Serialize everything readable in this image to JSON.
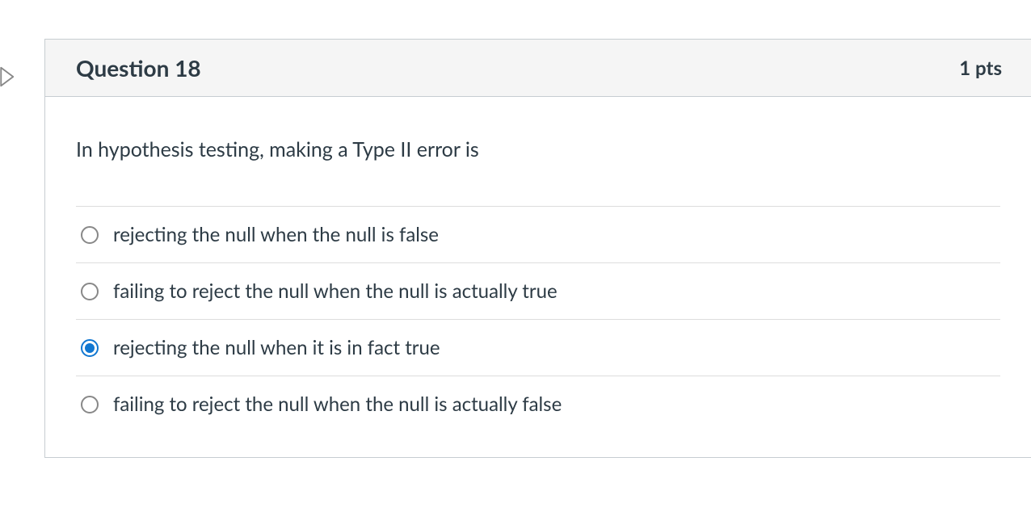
{
  "question": {
    "title": "Question 18",
    "points": "1 pts",
    "prompt": "In hypothesis testing, making a Type II error is",
    "answers": [
      {
        "text": "rejecting the null when the null is false",
        "selected": false
      },
      {
        "text": "failing to reject the null when the null is actually true",
        "selected": false
      },
      {
        "text": "rejecting the null when it is in fact true",
        "selected": true
      },
      {
        "text": "failing to reject the null when the null is actually false",
        "selected": false
      }
    ]
  }
}
